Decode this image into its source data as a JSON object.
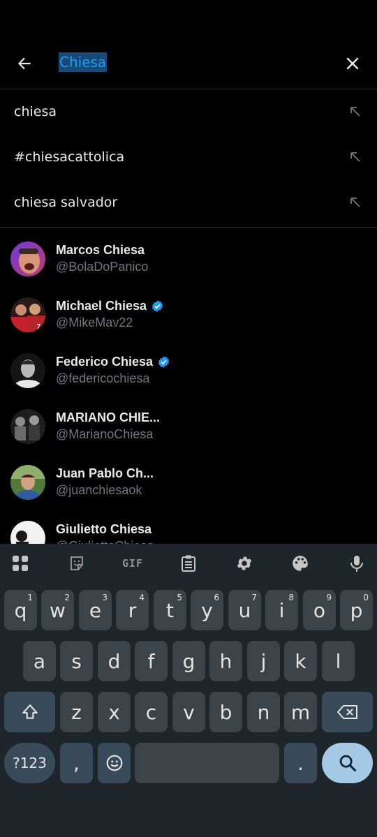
{
  "search": {
    "query": "Chiesa"
  },
  "suggestions": [
    {
      "label": "chiesa"
    },
    {
      "label": "#chiesacattolica"
    },
    {
      "label": "chiesa salvador"
    }
  ],
  "users": [
    {
      "name": "Marcos Chiesa",
      "handle": "@BolaDoPanico",
      "verified": false
    },
    {
      "name": "Michael Chiesa",
      "handle": "@MikeMav22",
      "verified": true
    },
    {
      "name": "Federico Chiesa",
      "handle": "@federicochiesa",
      "verified": true
    },
    {
      "name": "MARIANO CHIE...",
      "handle": "@MarianoChiesa",
      "verified": false
    },
    {
      "name": "Juan Pablo Ch...",
      "handle": "@juanchiesaok",
      "verified": false
    },
    {
      "name": "Giulietto Chiesa",
      "handle": "@GiuliettoChiesa",
      "verified": false
    }
  ],
  "keyboard": {
    "toolbar": {
      "gif_label": "GIF"
    },
    "row1": [
      {
        "key": "q",
        "hint": "1"
      },
      {
        "key": "w",
        "hint": "2"
      },
      {
        "key": "e",
        "hint": "3"
      },
      {
        "key": "r",
        "hint": "4"
      },
      {
        "key": "t",
        "hint": "5"
      },
      {
        "key": "y",
        "hint": "6"
      },
      {
        "key": "u",
        "hint": "7"
      },
      {
        "key": "i",
        "hint": "8"
      },
      {
        "key": "o",
        "hint": "9"
      },
      {
        "key": "p",
        "hint": "0"
      }
    ],
    "row2": [
      "a",
      "s",
      "d",
      "f",
      "g",
      "h",
      "j",
      "k",
      "l"
    ],
    "row3": [
      "z",
      "x",
      "c",
      "v",
      "b",
      "n",
      "m"
    ],
    "symbols_label": "?123",
    "comma": ",",
    "period": "."
  },
  "colors": {
    "accent": "#1d9bf0",
    "background": "#000000",
    "keyboard_bg": "#1f262b",
    "key_bg": "#3c4449",
    "enter_bg": "#a5c8e4"
  }
}
